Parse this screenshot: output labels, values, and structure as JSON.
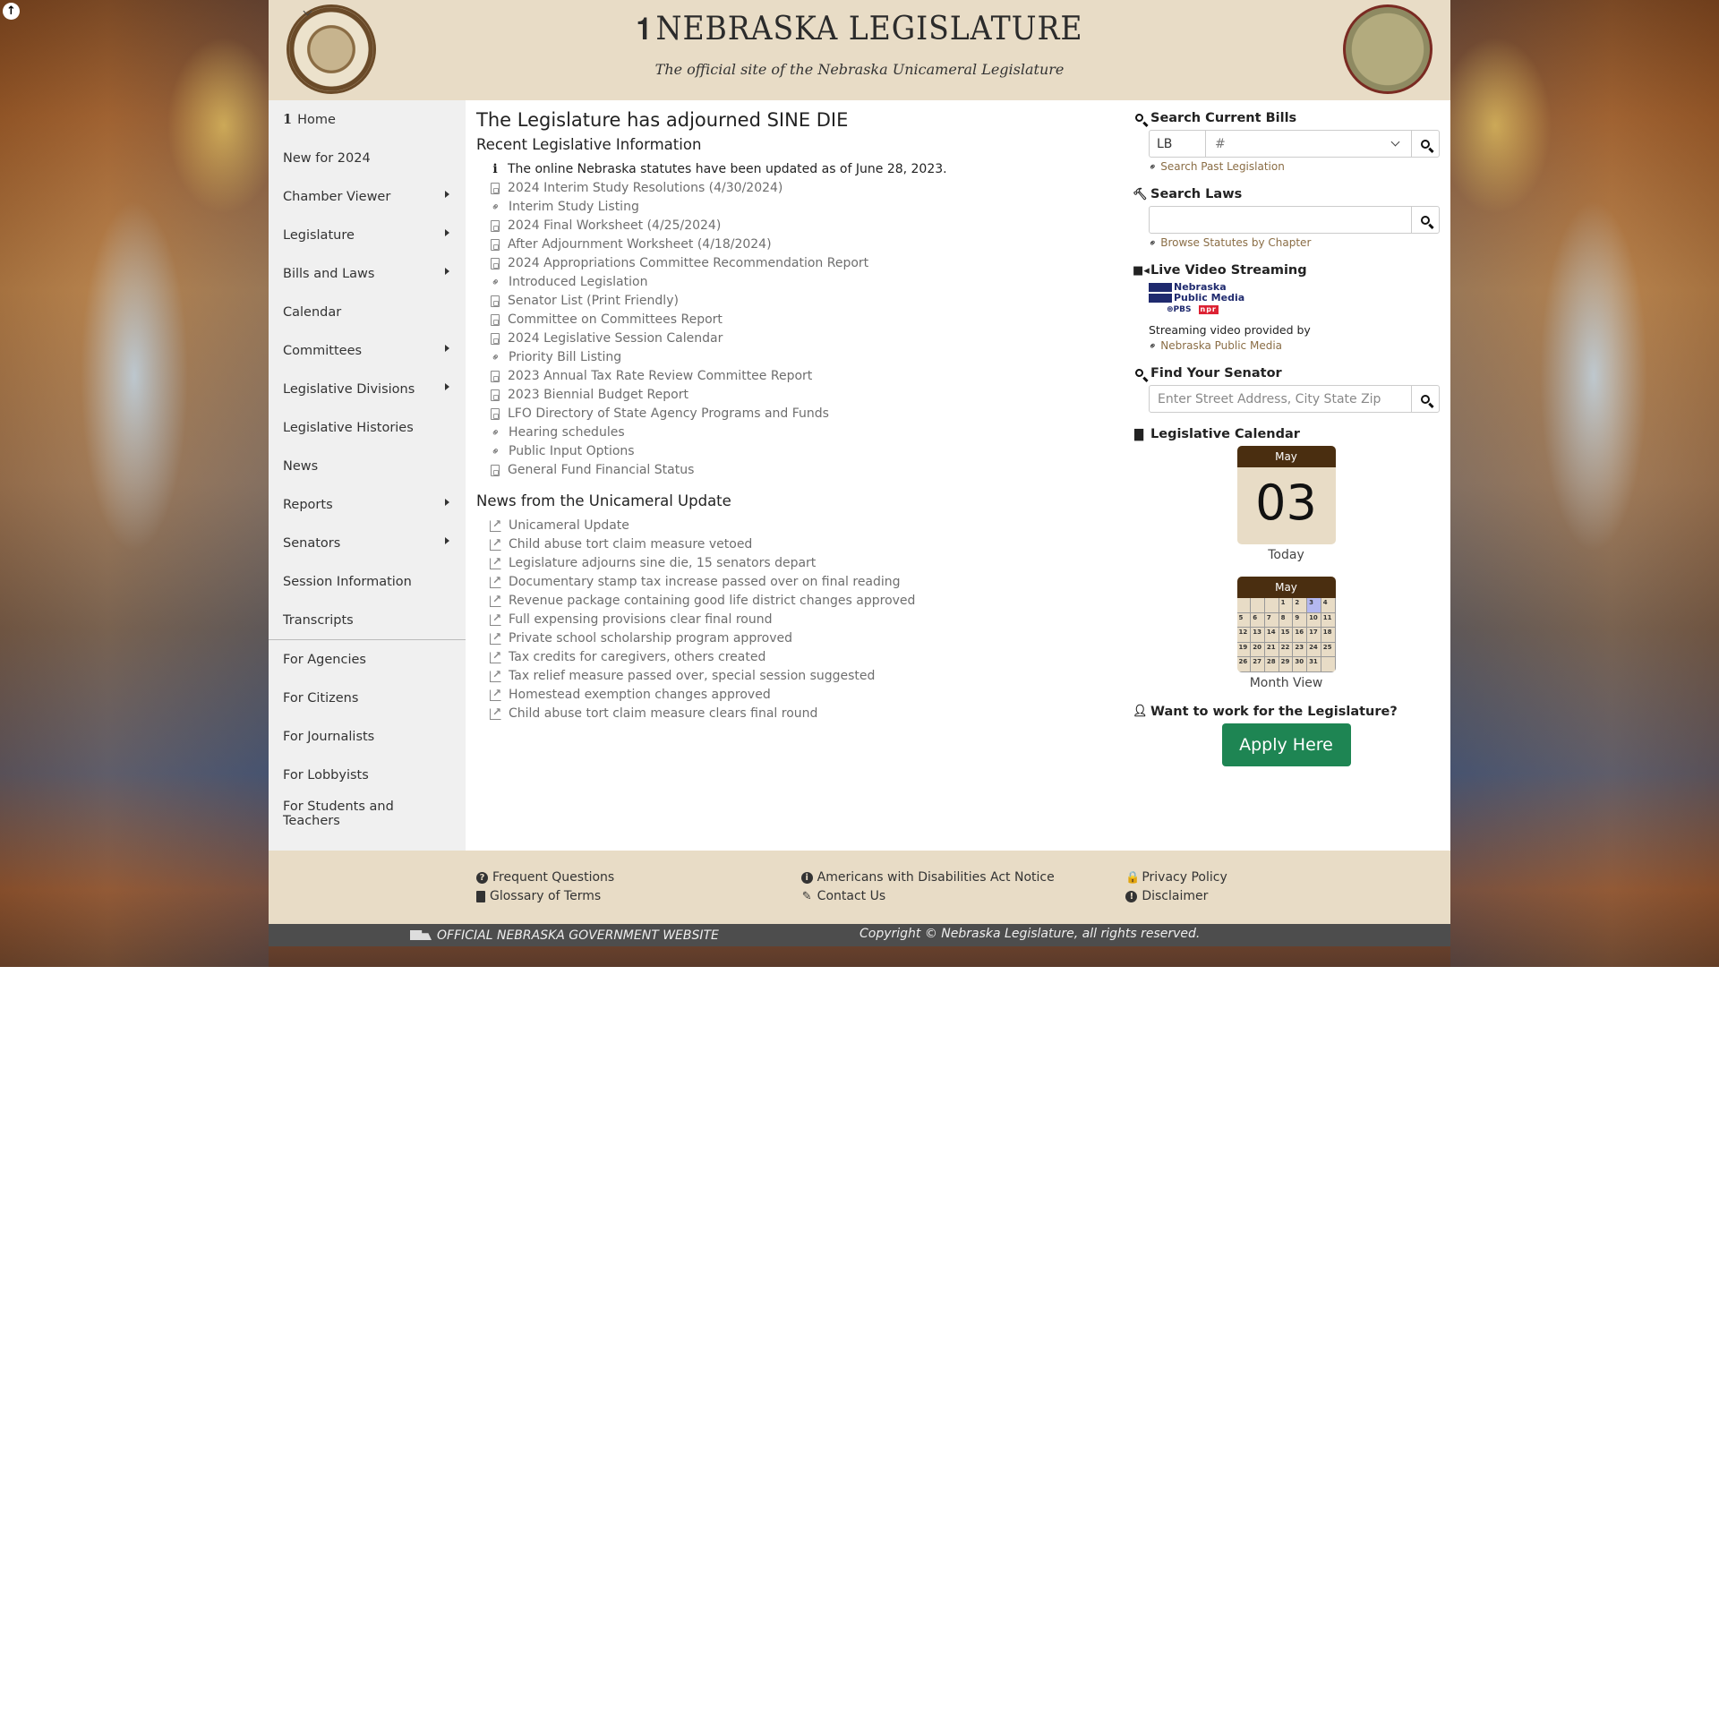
{
  "scroll_top_icon": "↑",
  "header": {
    "title": "NEBRASKA LEGISLATURE",
    "lamp_icon": "𝟏",
    "subtitle": "The official site of the Nebraska Unicameral Legislature"
  },
  "sidebar": {
    "home_icon": "ℹ",
    "items": [
      {
        "label": "Home",
        "submenu": false
      },
      {
        "label": "New for 2024",
        "submenu": false
      },
      {
        "label": "Chamber Viewer",
        "submenu": true
      },
      {
        "label": "Legislature",
        "submenu": true
      },
      {
        "label": "Bills and Laws",
        "submenu": true
      },
      {
        "label": "Calendar",
        "submenu": false
      },
      {
        "label": "Committees",
        "submenu": true
      },
      {
        "label": "Legislative Divisions",
        "submenu": true
      },
      {
        "label": "Legislative Histories",
        "submenu": false
      },
      {
        "label": "News",
        "submenu": false
      },
      {
        "label": "Reports",
        "submenu": true
      },
      {
        "label": "Senators",
        "submenu": true
      },
      {
        "label": "Session Information",
        "submenu": false
      },
      {
        "label": "Transcripts",
        "submenu": false
      }
    ],
    "audience_items": [
      {
        "label": "For Agencies"
      },
      {
        "label": "For Citizens"
      },
      {
        "label": "For Journalists"
      },
      {
        "label": "For Lobbyists"
      },
      {
        "label": "For Students and Teachers"
      }
    ]
  },
  "main": {
    "heading": "The Legislature has adjourned SINE DIE",
    "recent_heading": "Recent Legislative Information",
    "recent_items": [
      {
        "icon": "info-icon",
        "text": "The online Nebraska statutes have been updated as of June 28, 2023."
      },
      {
        "icon": "pdf-icon",
        "text": "2024 Interim Study Resolutions (4/30/2024)"
      },
      {
        "icon": "link-icon",
        "text": "Interim Study Listing"
      },
      {
        "icon": "pdf-icon",
        "text": "2024 Final Worksheet (4/25/2024)"
      },
      {
        "icon": "pdf-icon",
        "text": "After Adjournment Worksheet (4/18/2024)"
      },
      {
        "icon": "pdf-icon",
        "text": "2024 Appropriations Committee Recommendation Report"
      },
      {
        "icon": "link-icon",
        "text": "Introduced Legislation"
      },
      {
        "icon": "pdf-icon",
        "text": "Senator List (Print Friendly)"
      },
      {
        "icon": "pdf-icon",
        "text": "Committee on Committees Report"
      },
      {
        "icon": "pdf-icon",
        "text": "2024 Legislative Session Calendar"
      },
      {
        "icon": "link-icon",
        "text": "Priority Bill Listing"
      },
      {
        "icon": "pdf-icon",
        "text": "2023 Annual Tax Rate Review Committee Report"
      },
      {
        "icon": "pdf-icon",
        "text": "2023 Biennial Budget Report"
      },
      {
        "icon": "pdf-icon",
        "text": "LFO Directory of State Agency Programs and Funds"
      },
      {
        "icon": "link-icon",
        "text": "Hearing schedules"
      },
      {
        "icon": "link-icon",
        "text": "Public Input Options"
      },
      {
        "icon": "pdf-icon",
        "text": "General Fund Financial Status"
      }
    ],
    "news_heading": "News from the Unicameral Update",
    "news_items": [
      "Unicameral Update",
      "Child abuse tort claim measure vetoed",
      "Legislature adjourns sine die, 15 senators depart",
      "Documentary stamp tax increase passed over on final reading",
      "Revenue package containing good life district changes approved",
      "Full expensing provisions clear final round",
      "Private school scholarship program approved",
      "Tax credits for caregivers, others created",
      "Tax relief measure passed over, special session suggested",
      "Homestead exemption changes approved",
      "Child abuse tort claim measure clears final round"
    ]
  },
  "right": {
    "search_bills": {
      "heading": "Search Current Bills",
      "type_value": "LB",
      "number_placeholder": "#",
      "past_link": "Search Past Legislation"
    },
    "search_laws": {
      "heading": "Search Laws",
      "value": "",
      "browse_link": "Browse Statutes by Chapter"
    },
    "video": {
      "heading": "Live Video Streaming",
      "logo_line1": "Nebraska",
      "logo_line2": "Public Media",
      "pbs": "PBS",
      "npr": "npr",
      "provided_text": "Streaming video provided by",
      "provider_link": "Nebraska Public Media"
    },
    "senator": {
      "heading": "Find Your Senator",
      "placeholder": "Enter Street Address, City State Zip"
    },
    "calendar": {
      "heading": "Legislative Calendar",
      "today_month": "May",
      "today_day": "03",
      "today_label": "Today",
      "month_name": "May",
      "month_label": "Month View",
      "highlight_day": "3",
      "days": [
        "",
        "",
        "",
        "1",
        "2",
        "3",
        "4",
        "5",
        "6",
        "7",
        "8",
        "9",
        "10",
        "11",
        "12",
        "13",
        "14",
        "15",
        "16",
        "17",
        "18",
        "19",
        "20",
        "21",
        "22",
        "23",
        "24",
        "25",
        "26",
        "27",
        "28",
        "29",
        "30",
        "31",
        ""
      ]
    },
    "jobs": {
      "heading": "Want to work for the Legislature?",
      "button": "Apply Here",
      "button_color": "#1e8553"
    }
  },
  "footer": {
    "col1": [
      {
        "icon": "question-circle-icon",
        "glyph": "?",
        "label": "Frequent Questions"
      },
      {
        "icon": "book-icon",
        "glyph": "",
        "label": "Glossary of Terms"
      }
    ],
    "col2": [
      {
        "icon": "info-circle-icon",
        "glyph": "i",
        "label": "Americans with Disabilities Act Notice"
      },
      {
        "icon": "pencil-icon",
        "glyph": "✎",
        "label": "Contact Us"
      }
    ],
    "col3": [
      {
        "icon": "lock-icon",
        "glyph": "🔒",
        "label": "Privacy Policy"
      },
      {
        "icon": "exclamation-circle-icon",
        "glyph": "!",
        "label": "Disclaimer"
      }
    ],
    "official": "OFFICIAL NEBRASKA GOVERNMENT WEBSITE",
    "copyright": "Copyright © Nebraska Legislature, all rights reserved."
  },
  "colors": {
    "header_bg": "#e8dcc6",
    "calendar_head": "#4a2e10",
    "link_brown": "#8a6d45",
    "apply_green": "#1e8553",
    "gov_bar": "#4d4d4d"
  }
}
